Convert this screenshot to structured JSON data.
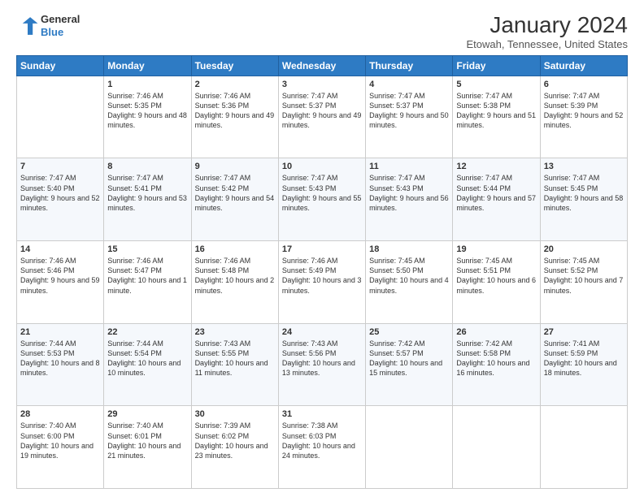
{
  "header": {
    "logo_line1": "General",
    "logo_line2": "Blue",
    "title": "January 2024",
    "location": "Etowah, Tennessee, United States"
  },
  "days_of_week": [
    "Sunday",
    "Monday",
    "Tuesday",
    "Wednesday",
    "Thursday",
    "Friday",
    "Saturday"
  ],
  "weeks": [
    [
      {
        "day": "",
        "sunrise": "",
        "sunset": "",
        "daylight": ""
      },
      {
        "day": "1",
        "sunrise": "Sunrise: 7:46 AM",
        "sunset": "Sunset: 5:35 PM",
        "daylight": "Daylight: 9 hours and 48 minutes."
      },
      {
        "day": "2",
        "sunrise": "Sunrise: 7:46 AM",
        "sunset": "Sunset: 5:36 PM",
        "daylight": "Daylight: 9 hours and 49 minutes."
      },
      {
        "day": "3",
        "sunrise": "Sunrise: 7:47 AM",
        "sunset": "Sunset: 5:37 PM",
        "daylight": "Daylight: 9 hours and 49 minutes."
      },
      {
        "day": "4",
        "sunrise": "Sunrise: 7:47 AM",
        "sunset": "Sunset: 5:37 PM",
        "daylight": "Daylight: 9 hours and 50 minutes."
      },
      {
        "day": "5",
        "sunrise": "Sunrise: 7:47 AM",
        "sunset": "Sunset: 5:38 PM",
        "daylight": "Daylight: 9 hours and 51 minutes."
      },
      {
        "day": "6",
        "sunrise": "Sunrise: 7:47 AM",
        "sunset": "Sunset: 5:39 PM",
        "daylight": "Daylight: 9 hours and 52 minutes."
      }
    ],
    [
      {
        "day": "7",
        "sunrise": "Sunrise: 7:47 AM",
        "sunset": "Sunset: 5:40 PM",
        "daylight": "Daylight: 9 hours and 52 minutes."
      },
      {
        "day": "8",
        "sunrise": "Sunrise: 7:47 AM",
        "sunset": "Sunset: 5:41 PM",
        "daylight": "Daylight: 9 hours and 53 minutes."
      },
      {
        "day": "9",
        "sunrise": "Sunrise: 7:47 AM",
        "sunset": "Sunset: 5:42 PM",
        "daylight": "Daylight: 9 hours and 54 minutes."
      },
      {
        "day": "10",
        "sunrise": "Sunrise: 7:47 AM",
        "sunset": "Sunset: 5:43 PM",
        "daylight": "Daylight: 9 hours and 55 minutes."
      },
      {
        "day": "11",
        "sunrise": "Sunrise: 7:47 AM",
        "sunset": "Sunset: 5:43 PM",
        "daylight": "Daylight: 9 hours and 56 minutes."
      },
      {
        "day": "12",
        "sunrise": "Sunrise: 7:47 AM",
        "sunset": "Sunset: 5:44 PM",
        "daylight": "Daylight: 9 hours and 57 minutes."
      },
      {
        "day": "13",
        "sunrise": "Sunrise: 7:47 AM",
        "sunset": "Sunset: 5:45 PM",
        "daylight": "Daylight: 9 hours and 58 minutes."
      }
    ],
    [
      {
        "day": "14",
        "sunrise": "Sunrise: 7:46 AM",
        "sunset": "Sunset: 5:46 PM",
        "daylight": "Daylight: 9 hours and 59 minutes."
      },
      {
        "day": "15",
        "sunrise": "Sunrise: 7:46 AM",
        "sunset": "Sunset: 5:47 PM",
        "daylight": "Daylight: 10 hours and 1 minute."
      },
      {
        "day": "16",
        "sunrise": "Sunrise: 7:46 AM",
        "sunset": "Sunset: 5:48 PM",
        "daylight": "Daylight: 10 hours and 2 minutes."
      },
      {
        "day": "17",
        "sunrise": "Sunrise: 7:46 AM",
        "sunset": "Sunset: 5:49 PM",
        "daylight": "Daylight: 10 hours and 3 minutes."
      },
      {
        "day": "18",
        "sunrise": "Sunrise: 7:45 AM",
        "sunset": "Sunset: 5:50 PM",
        "daylight": "Daylight: 10 hours and 4 minutes."
      },
      {
        "day": "19",
        "sunrise": "Sunrise: 7:45 AM",
        "sunset": "Sunset: 5:51 PM",
        "daylight": "Daylight: 10 hours and 6 minutes."
      },
      {
        "day": "20",
        "sunrise": "Sunrise: 7:45 AM",
        "sunset": "Sunset: 5:52 PM",
        "daylight": "Daylight: 10 hours and 7 minutes."
      }
    ],
    [
      {
        "day": "21",
        "sunrise": "Sunrise: 7:44 AM",
        "sunset": "Sunset: 5:53 PM",
        "daylight": "Daylight: 10 hours and 8 minutes."
      },
      {
        "day": "22",
        "sunrise": "Sunrise: 7:44 AM",
        "sunset": "Sunset: 5:54 PM",
        "daylight": "Daylight: 10 hours and 10 minutes."
      },
      {
        "day": "23",
        "sunrise": "Sunrise: 7:43 AM",
        "sunset": "Sunset: 5:55 PM",
        "daylight": "Daylight: 10 hours and 11 minutes."
      },
      {
        "day": "24",
        "sunrise": "Sunrise: 7:43 AM",
        "sunset": "Sunset: 5:56 PM",
        "daylight": "Daylight: 10 hours and 13 minutes."
      },
      {
        "day": "25",
        "sunrise": "Sunrise: 7:42 AM",
        "sunset": "Sunset: 5:57 PM",
        "daylight": "Daylight: 10 hours and 15 minutes."
      },
      {
        "day": "26",
        "sunrise": "Sunrise: 7:42 AM",
        "sunset": "Sunset: 5:58 PM",
        "daylight": "Daylight: 10 hours and 16 minutes."
      },
      {
        "day": "27",
        "sunrise": "Sunrise: 7:41 AM",
        "sunset": "Sunset: 5:59 PM",
        "daylight": "Daylight: 10 hours and 18 minutes."
      }
    ],
    [
      {
        "day": "28",
        "sunrise": "Sunrise: 7:40 AM",
        "sunset": "Sunset: 6:00 PM",
        "daylight": "Daylight: 10 hours and 19 minutes."
      },
      {
        "day": "29",
        "sunrise": "Sunrise: 7:40 AM",
        "sunset": "Sunset: 6:01 PM",
        "daylight": "Daylight: 10 hours and 21 minutes."
      },
      {
        "day": "30",
        "sunrise": "Sunrise: 7:39 AM",
        "sunset": "Sunset: 6:02 PM",
        "daylight": "Daylight: 10 hours and 23 minutes."
      },
      {
        "day": "31",
        "sunrise": "Sunrise: 7:38 AM",
        "sunset": "Sunset: 6:03 PM",
        "daylight": "Daylight: 10 hours and 24 minutes."
      },
      {
        "day": "",
        "sunrise": "",
        "sunset": "",
        "daylight": ""
      },
      {
        "day": "",
        "sunrise": "",
        "sunset": "",
        "daylight": ""
      },
      {
        "day": "",
        "sunrise": "",
        "sunset": "",
        "daylight": ""
      }
    ]
  ]
}
